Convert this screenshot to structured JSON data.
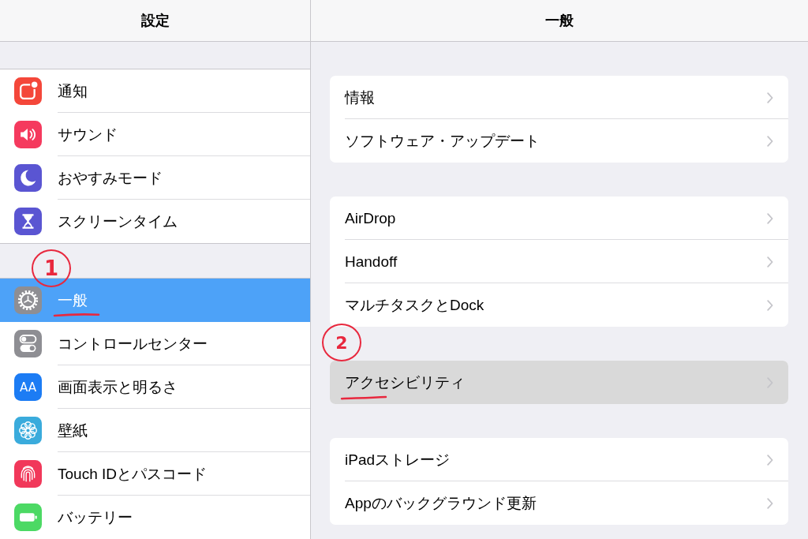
{
  "sidebar": {
    "title": "設定",
    "groups": [
      {
        "items": [
          {
            "label": "通知",
            "color": "#f4473a",
            "selected": false
          },
          {
            "label": "サウンド",
            "color": "#f53a5e",
            "selected": false
          },
          {
            "label": "おやすみモード",
            "color": "#5a55d2",
            "selected": false
          },
          {
            "label": "スクリーンタイム",
            "color": "#5a55d2",
            "selected": false
          }
        ]
      },
      {
        "items": [
          {
            "label": "一般",
            "color": "#8e8e93",
            "selected": true,
            "annotation": "1"
          },
          {
            "label": "コントロールセンター",
            "color": "#8e8e93",
            "selected": false
          },
          {
            "label": "画面表示と明るさ",
            "color": "#1c7cf4",
            "selected": false,
            "glyph": "AA"
          },
          {
            "label": "壁紙",
            "color": "#3aabdc",
            "selected": false
          },
          {
            "label": "Touch IDとパスコード",
            "color": "#f1385a",
            "selected": false
          },
          {
            "label": "バッテリー",
            "color": "#4cd964",
            "selected": false
          }
        ]
      }
    ]
  },
  "detail": {
    "title": "一般",
    "groups": [
      {
        "rows": [
          {
            "label": "情報",
            "pressed": false
          },
          {
            "label": "ソフトウェア・アップデート",
            "pressed": false
          }
        ]
      },
      {
        "rows": [
          {
            "label": "AirDrop",
            "pressed": false
          },
          {
            "label": "Handoff",
            "pressed": false
          },
          {
            "label": "マルチタスクとDock",
            "pressed": false
          }
        ]
      },
      {
        "rows": [
          {
            "label": "アクセシビリティ",
            "pressed": true,
            "annotation": "2"
          }
        ]
      },
      {
        "rows": [
          {
            "label": "iPadストレージ",
            "pressed": false
          },
          {
            "label": "Appのバックグラウンド更新",
            "pressed": false
          }
        ]
      }
    ]
  }
}
